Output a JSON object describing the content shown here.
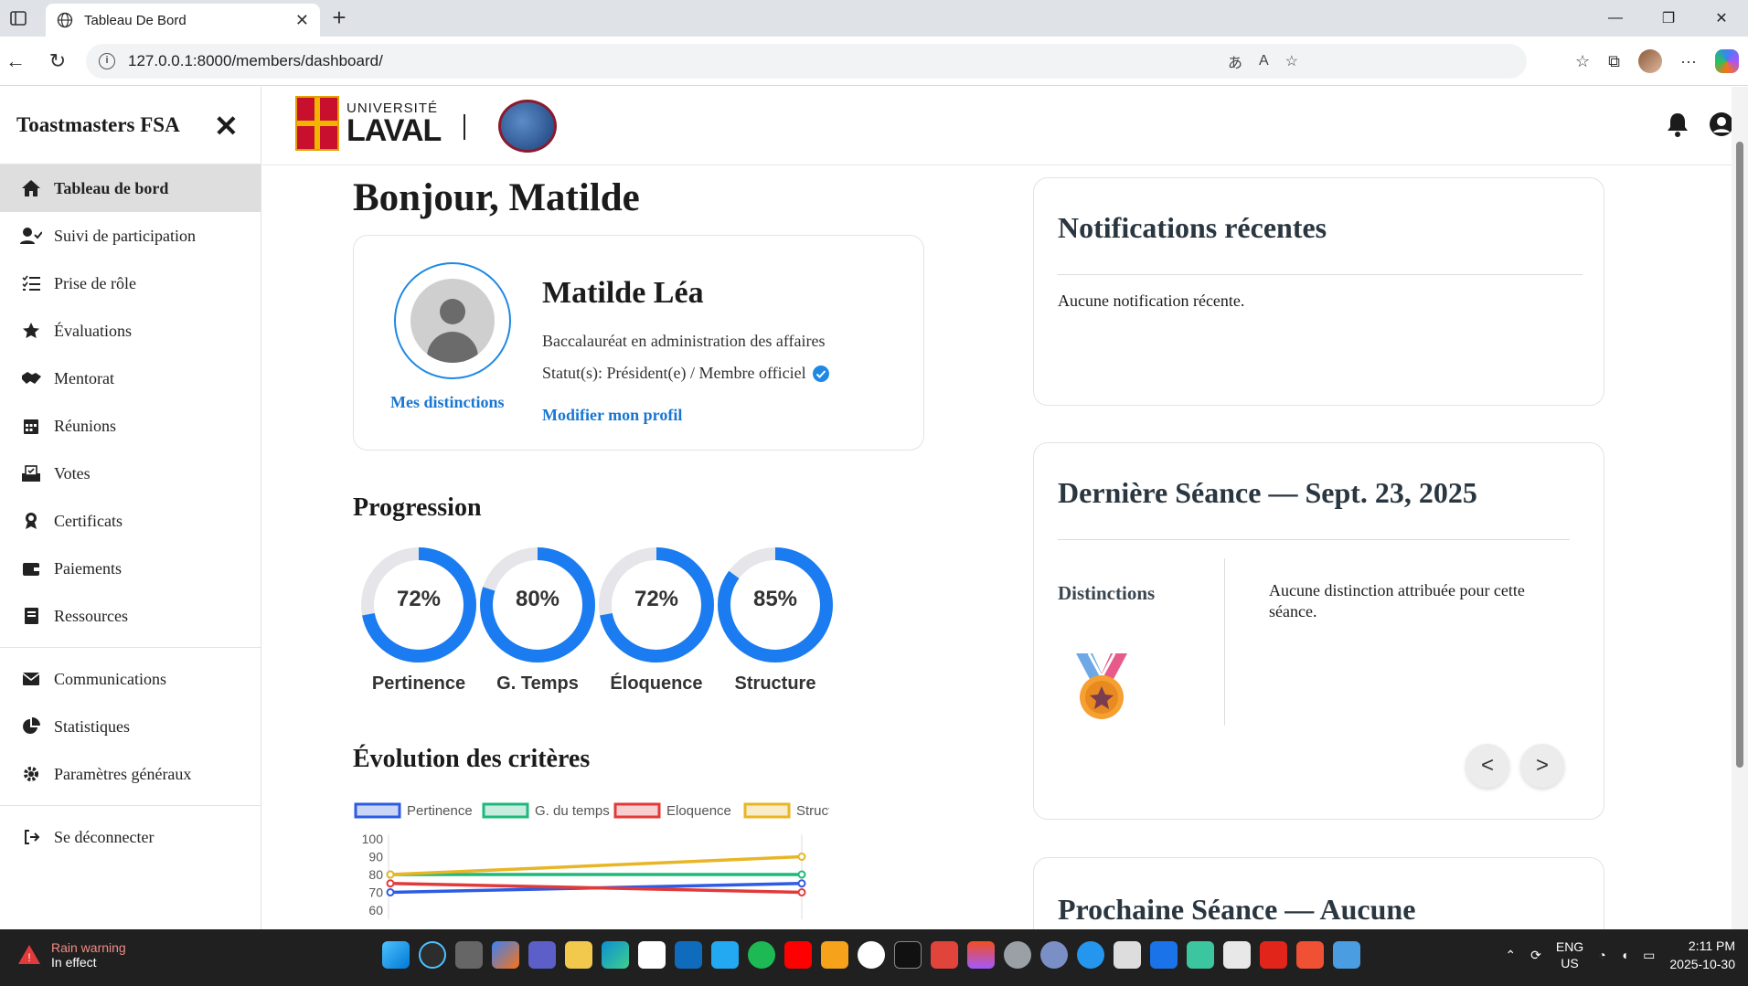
{
  "browser": {
    "tab_title": "Tableau De Bord",
    "url": "127.0.0.1:8000/members/dashboard/"
  },
  "sidebar": {
    "brand": "Toastmasters FSA",
    "items": [
      {
        "label": "Tableau de bord",
        "icon": "home-icon",
        "active": true
      },
      {
        "label": "Suivi de participation",
        "icon": "user-check-icon"
      },
      {
        "label": "Prise de rôle",
        "icon": "list-check-icon"
      },
      {
        "label": "Évaluations",
        "icon": "star-icon"
      },
      {
        "label": "Mentorat",
        "icon": "handshake-icon"
      },
      {
        "label": "Réunions",
        "icon": "calendar-icon"
      },
      {
        "label": "Votes",
        "icon": "ballot-icon"
      },
      {
        "label": "Certificats",
        "icon": "award-icon"
      },
      {
        "label": "Paiements",
        "icon": "wallet-icon"
      },
      {
        "label": "Ressources",
        "icon": "book-icon"
      }
    ],
    "items2": [
      {
        "label": "Communications",
        "icon": "envelope-icon"
      },
      {
        "label": "Statistiques",
        "icon": "pie-chart-icon"
      },
      {
        "label": "Paramètres généraux",
        "icon": "gear-icon"
      }
    ],
    "logout": "Se déconnecter"
  },
  "header": {
    "univ_small": "UNIVERSITÉ",
    "univ_big": "LAVAL"
  },
  "main": {
    "greeting": "Bonjour, Matilde",
    "profile": {
      "distinctions_link": "Mes distinctions",
      "name": "Matilde Léa",
      "program": "Baccalauréat en administration des affaires",
      "status": "Statut(s): Président(e) / Membre officiel",
      "edit_link": "Modifier mon profil"
    },
    "progression_title": "Progression",
    "gauges": [
      {
        "label": "Pertinence",
        "value": 72,
        "text": "72%"
      },
      {
        "label": "G. Temps",
        "value": 80,
        "text": "80%"
      },
      {
        "label": "Éloquence",
        "value": 72,
        "text": "72%"
      },
      {
        "label": "Structure",
        "value": 85,
        "text": "85%"
      }
    ],
    "evolution_title": "Évolution des critères"
  },
  "chart_data": {
    "type": "line",
    "title": "",
    "ylim": [
      60,
      100
    ],
    "yticks": [
      100,
      90,
      80,
      70,
      60
    ],
    "x": [
      1,
      2
    ],
    "series": [
      {
        "name": "Pertinence",
        "values": [
          70,
          75
        ],
        "color": "#2d5be3"
      },
      {
        "name": "G. du temps",
        "values": [
          80,
          80
        ],
        "color": "#1fb97a"
      },
      {
        "name": "Eloquence",
        "values": [
          75,
          70
        ],
        "color": "#e23a3a"
      },
      {
        "name": "Structure",
        "values": [
          80,
          90
        ],
        "color": "#e8b526"
      }
    ],
    "legend": "top",
    "grid": false
  },
  "right": {
    "notif_title": "Notifications récentes",
    "notif_empty": "Aucune notification récente.",
    "seance_title": "Dernière Séance — Sept. 23, 2025",
    "seance_dist_label": "Distinctions",
    "seance_none": "Aucune distinction attribuée pour cette séance.",
    "prev_label": "<",
    "next_label": ">",
    "next_title": "Prochaine Séance — Aucune"
  },
  "taskbar": {
    "weather_title": "Rain warning",
    "weather_sub": "In effect",
    "lang1": "ENG",
    "lang2": "US",
    "time": "2:11 PM",
    "date": "2025-10-30"
  },
  "colors": {
    "accent": "#1e88e5",
    "link": "#1976d2",
    "gauge_track": "#e6e6ea",
    "gauge_fill": "#1a7cf0"
  }
}
